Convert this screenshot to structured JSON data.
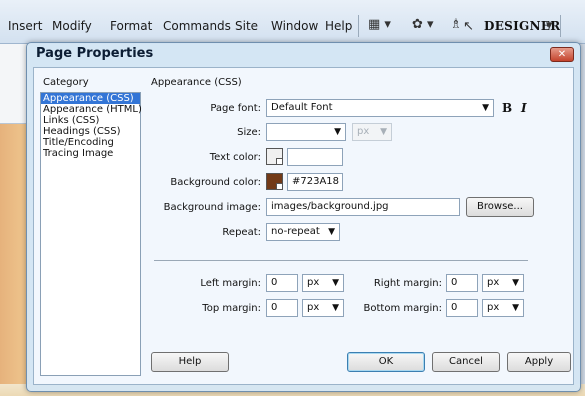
{
  "menubar": {
    "items": [
      "Insert",
      "Modify",
      "Format",
      "Commands",
      "Site",
      "Window",
      "Help"
    ],
    "workspace_label": "DESIGNER"
  },
  "dialog": {
    "title": "Page Properties",
    "category_label": "Category",
    "categories": [
      {
        "label": "Appearance (CSS)",
        "selected": true
      },
      {
        "label": "Appearance (HTML)",
        "selected": false
      },
      {
        "label": "Links (CSS)",
        "selected": false
      },
      {
        "label": "Headings (CSS)",
        "selected": false
      },
      {
        "label": "Title/Encoding",
        "selected": false
      },
      {
        "label": "Tracing Image",
        "selected": false
      }
    ],
    "section_title": "Appearance (CSS)",
    "page_font": {
      "label": "Page font:",
      "value": "Default Font"
    },
    "bold_label": "B",
    "italic_label": "I",
    "size": {
      "label": "Size:",
      "value": "",
      "unit": "px"
    },
    "text_color": {
      "label": "Text color:",
      "value": ""
    },
    "background_color": {
      "label": "Background color:",
      "value": "#723A18",
      "swatch": "#723A18"
    },
    "background_image": {
      "label": "Background image:",
      "value": "images/background.jpg"
    },
    "browse_button": "Browse...",
    "repeat": {
      "label": "Repeat:",
      "value": "no-repeat"
    },
    "left_margin": {
      "label": "Left margin:",
      "value": "0",
      "unit": "px"
    },
    "right_margin": {
      "label": "Right margin:",
      "value": "0",
      "unit": "px"
    },
    "top_margin": {
      "label": "Top margin:",
      "value": "0",
      "unit": "px"
    },
    "bottom_margin": {
      "label": "Bottom margin:",
      "value": "0",
      "unit": "px"
    },
    "buttons": {
      "help": "Help",
      "ok": "OK",
      "cancel": "Cancel",
      "apply": "Apply"
    }
  }
}
